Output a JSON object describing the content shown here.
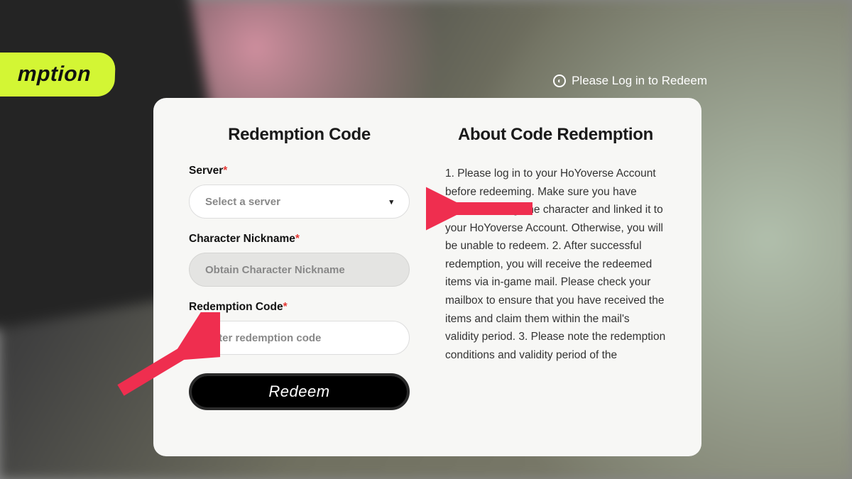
{
  "badge": {
    "text": "mption"
  },
  "login_hint": {
    "text": "Please Log in to Redeem"
  },
  "form": {
    "heading": "Redemption Code",
    "server": {
      "label": "Server",
      "placeholder": "Select a server"
    },
    "nickname": {
      "label": "Character Nickname",
      "placeholder": "Obtain Character Nickname"
    },
    "code": {
      "label": "Redemption Code",
      "placeholder": "Enter redemption code"
    },
    "submit": "Redeem"
  },
  "info": {
    "heading": "About Code Redemption",
    "body": "1. Please log in to your HoYoverse Account before redeeming. Make sure you have created an in-game character and linked it to your HoYoverse Account. Otherwise, you will be unable to redeem.\n2. After successful redemption, you will receive the redeemed items via in-game mail. Please check your mailbox to ensure that you have received the items and claim them within the mail's validity period.\n3. Please note the redemption conditions and validity period of the"
  }
}
